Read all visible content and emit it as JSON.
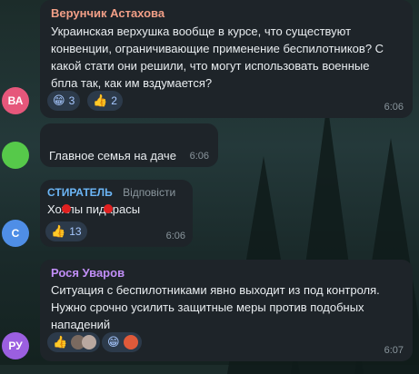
{
  "messages": [
    {
      "author": "Верунчик Астахова",
      "author_color": "#f29f87",
      "avatar_text": "ВА",
      "avatar_color": "#e6577b",
      "text_lines": [
        "Украинская верхушка вообще в курсе, что существуют",
        "конвенции, ограничивающие применение беспилотников? С",
        "какой стати они решили, что могут использовать военные",
        "бпла так, как им вздумается?"
      ],
      "reactions": [
        {
          "emoji": "😁",
          "emoji_name": "grin-icon",
          "count": "3"
        },
        {
          "emoji": "👍",
          "emoji_name": "thumbs-up-icon",
          "count": "2"
        }
      ],
      "time": "6:06"
    },
    {
      "author": "",
      "avatar_color": "#56c94a",
      "text": "Главное семья на даче",
      "time": "6:06"
    },
    {
      "author": "СТИРАТЕЛЬ",
      "author_color": "#6cb6f7",
      "suffix": "Відповісти",
      "avatar_text": "С",
      "avatar_color": "#4f8ee6",
      "text": "Хохлы пидарасы",
      "reactions": [
        {
          "emoji": "👍",
          "emoji_name": "thumbs-up-icon",
          "count": "13"
        }
      ],
      "time": "6:06"
    },
    {
      "author": "Рося Уваров",
      "author_color": "#c18ef7",
      "avatar_text": "РУ",
      "avatar_color": "#9b5fe0",
      "text_lines": [
        "Ситуация с беспилотниками явно выходит из под контроля.",
        "Нужно срочно усилить защитные меры против подобных",
        "нападений"
      ],
      "reactions": [
        {
          "emoji": "👍",
          "emoji_name": "thumbs-up-icon"
        },
        {
          "emoji": "😁",
          "emoji_name": "grin-icon"
        }
      ],
      "time": "6:07"
    }
  ]
}
